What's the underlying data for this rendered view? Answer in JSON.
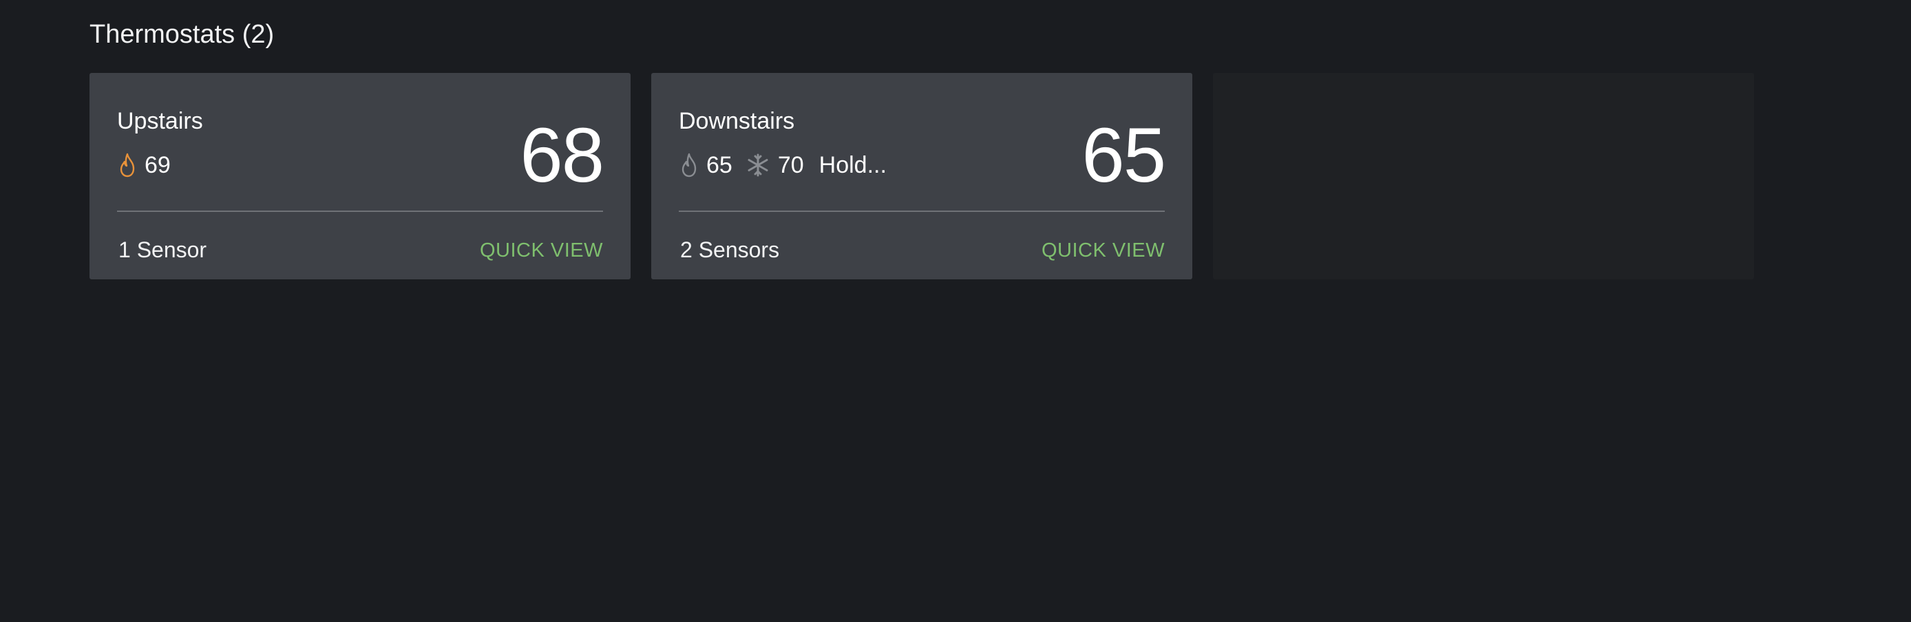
{
  "section": {
    "title": "Thermostats (2)"
  },
  "thermostats": [
    {
      "name": "Upstairs",
      "heat_setpoint": "69",
      "current_temp": "68",
      "sensors": "1 Sensor",
      "quick_view": "QUICK VIEW",
      "heat_icon": "flame-icon",
      "heat_icon_color": "#e8923a"
    },
    {
      "name": "Downstairs",
      "heat_setpoint": "65",
      "cool_setpoint": "70",
      "hold": "Hold...",
      "current_temp": "65",
      "sensors": "2 Sensors",
      "quick_view": "QUICK VIEW",
      "heat_icon": "flame-icon",
      "cool_icon": "snowflake-icon",
      "heat_icon_color": "#8a8d92"
    }
  ],
  "colors": {
    "background": "#1a1c20",
    "card": "#3e4147",
    "accent_green": "#7fbf6e"
  }
}
